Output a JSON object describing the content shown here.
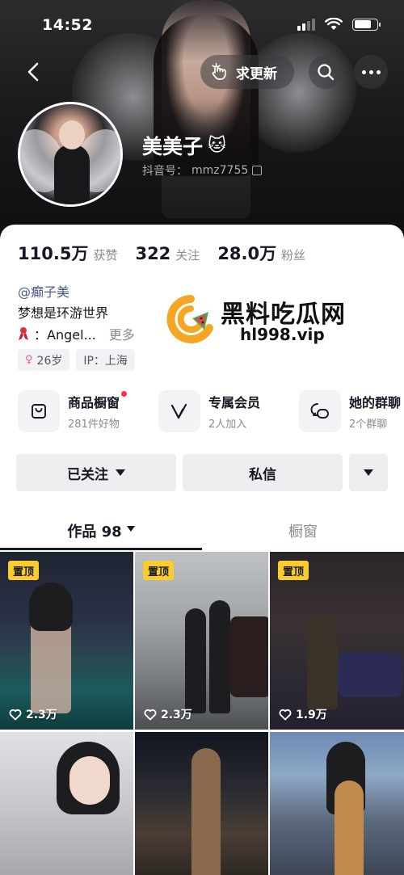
{
  "status_bar": {
    "time": "14:52"
  },
  "header": {
    "update_button_label": "求更新"
  },
  "profile": {
    "name": "美美子",
    "name_emoji": "🐱",
    "douyin_id_label": "抖音号：",
    "douyin_id": "mmz7755"
  },
  "stats": [
    {
      "value": "110.5万",
      "label": "获赞"
    },
    {
      "value": "322",
      "label": "关注"
    },
    {
      "value": "28.0万",
      "label": "粉丝"
    }
  ],
  "bio": {
    "handle": "@癫子美",
    "line1": "梦想是环游世界",
    "line2": "：Angel...",
    "more": "更多"
  },
  "tags": {
    "age": "26岁",
    "ip": "IP：上海"
  },
  "features": [
    {
      "title": "商品橱窗",
      "subtitle": "281件好物",
      "icon": "bag-icon"
    },
    {
      "title": "专属会员",
      "subtitle": "2人加入",
      "icon": "vip-v-icon"
    },
    {
      "title": "她的群聊",
      "subtitle": "2个群聊",
      "icon": "chat-bubbles-icon"
    }
  ],
  "actions": {
    "follow_label": "已关注",
    "message_label": "私信"
  },
  "tabs": {
    "works_label": "作品 98",
    "showcase_label": "橱窗"
  },
  "videos": [
    {
      "pinned": "置顶",
      "likes": "2.3万"
    },
    {
      "pinned": "置顶",
      "likes": "2.3万"
    },
    {
      "pinned": "置顶",
      "likes": "1.9万"
    }
  ],
  "watermark": {
    "title": "黑料吃瓜网",
    "url": "hl998.vip"
  },
  "colors": {
    "accent_red": "#fe2c55",
    "pin_yellow": "#facc2e",
    "watermark_orange": "#f5a623"
  }
}
